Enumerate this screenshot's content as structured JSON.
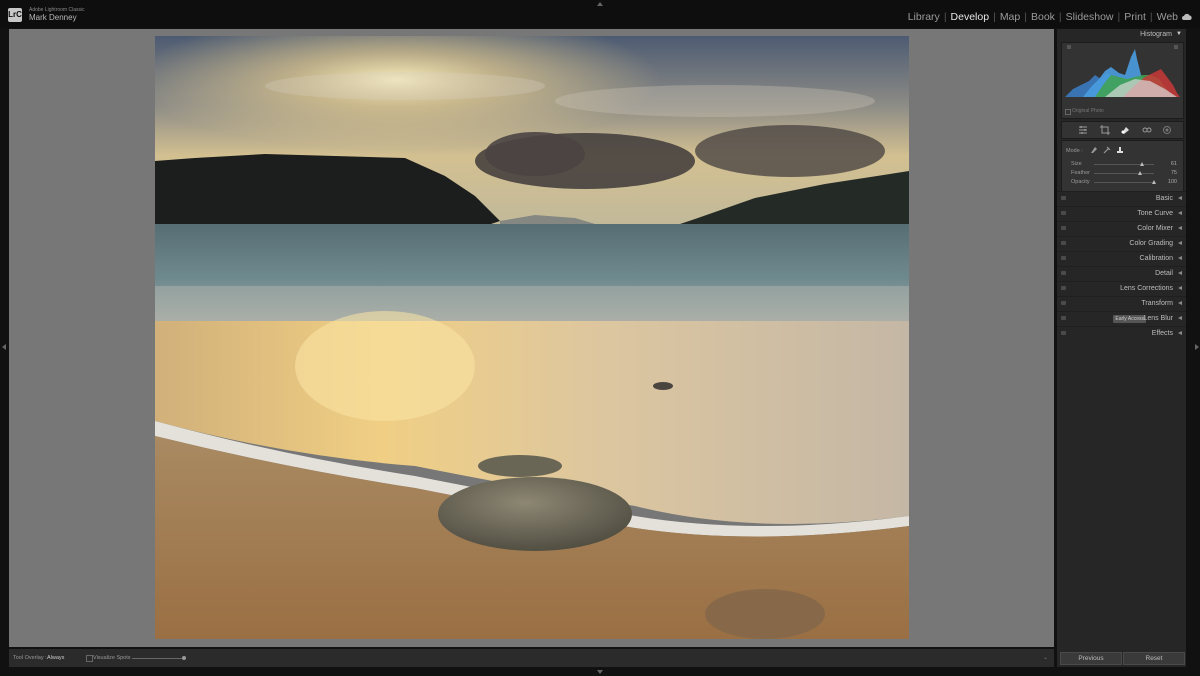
{
  "app": {
    "name": "Adobe Lightroom Classic",
    "logo_text": "LrC",
    "user": "Mark Denney"
  },
  "modules": [
    "Library",
    "Develop",
    "Map",
    "Book",
    "Slideshow",
    "Print",
    "Web"
  ],
  "active_module": "Develop",
  "histogram": {
    "title": "Histogram",
    "original_photo_label": "Original Photo"
  },
  "mask": {
    "mode_label": "Mode :",
    "rows": [
      {
        "label": "Size",
        "value": "61",
        "level": 0.8
      },
      {
        "label": "Feather",
        "value": "75",
        "level": 0.75
      },
      {
        "label": "Opacity",
        "value": "100",
        "level": 1.0
      }
    ]
  },
  "sections": [
    {
      "label": "Basic"
    },
    {
      "label": "Tone Curve"
    },
    {
      "label": "Color Mixer"
    },
    {
      "label": "Color Grading"
    },
    {
      "label": "Calibration"
    },
    {
      "label": "Detail"
    },
    {
      "label": "Lens Corrections"
    },
    {
      "label": "Transform"
    },
    {
      "label": "Lens Blur",
      "badge": "Early Access"
    },
    {
      "label": "Effects"
    }
  ],
  "toolbar": {
    "tool_overlay_label": "Tool Overlay :",
    "tool_overlay_value": "Always",
    "visualize_spots_label": "Visualize Spots"
  },
  "buttons": {
    "previous": "Previous",
    "reset": "Reset"
  },
  "colors": {
    "panel_bg": "#262626",
    "canvas_bg": "#777777",
    "active_module": "#e6e6e6"
  },
  "icons": [
    "cloud-icon",
    "basic-edit-icon",
    "crop-icon",
    "heal-icon",
    "red-eye-icon",
    "masking-icon",
    "heal-mode-icon",
    "clone-mode-icon",
    "content-aware-icon"
  ]
}
